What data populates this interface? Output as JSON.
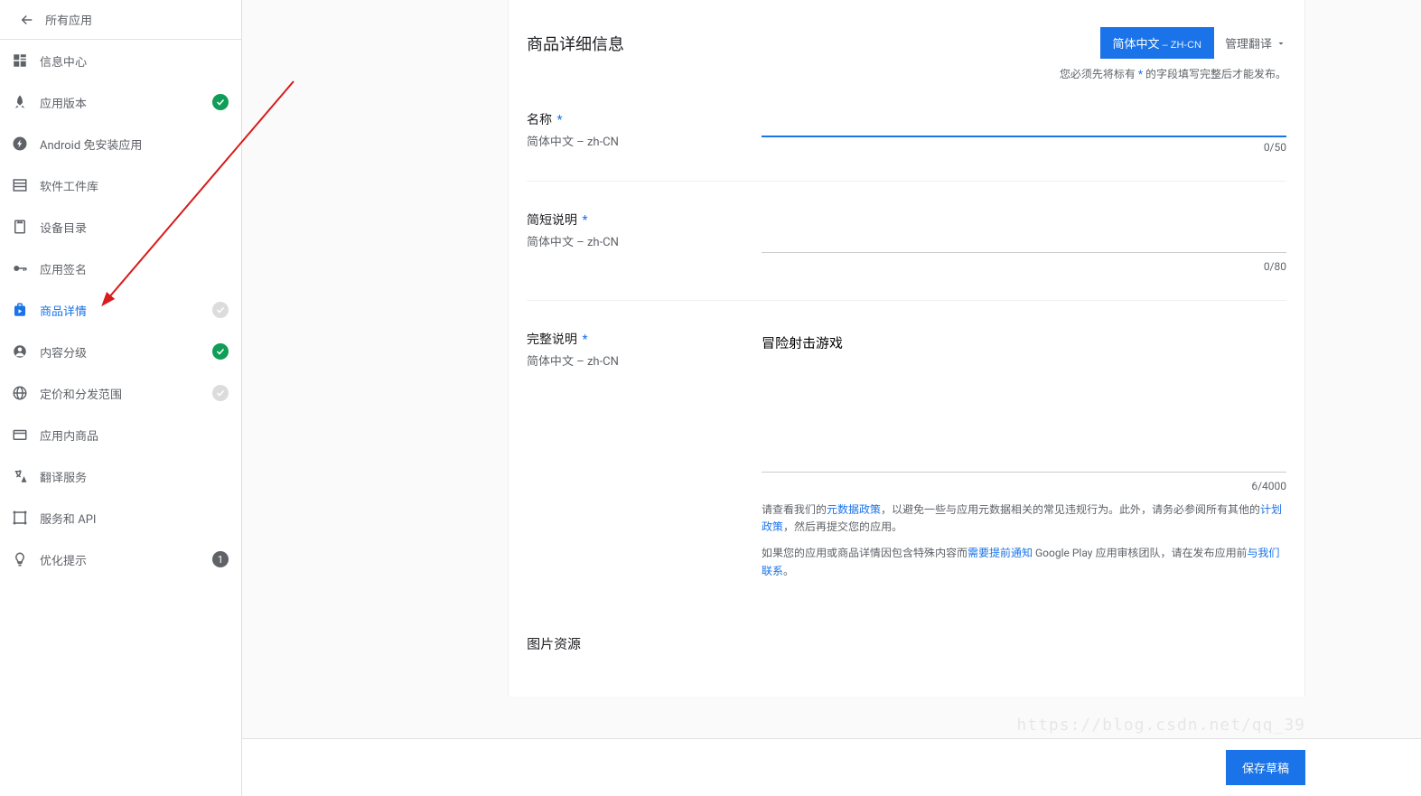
{
  "sidebar": {
    "back_label": "所有应用",
    "items": [
      {
        "label": "信息中心",
        "icon": "dashboard",
        "status": null,
        "active": false
      },
      {
        "label": "应用版本",
        "icon": "rocket",
        "status": "complete",
        "active": false
      },
      {
        "label": "Android 免安装应用",
        "icon": "bolt",
        "status": null,
        "active": false
      },
      {
        "label": "软件工件库",
        "icon": "library",
        "status": null,
        "active": false
      },
      {
        "label": "设备目录",
        "icon": "device",
        "status": null,
        "active": false
      },
      {
        "label": "应用签名",
        "icon": "key",
        "status": null,
        "active": false
      },
      {
        "label": "商品详情",
        "icon": "shop",
        "status": "incomplete",
        "active": true
      },
      {
        "label": "内容分级",
        "icon": "rating",
        "status": "complete",
        "active": false
      },
      {
        "label": "定价和分发范围",
        "icon": "globe",
        "status": "incomplete",
        "active": false
      },
      {
        "label": "应用内商品",
        "icon": "card",
        "status": null,
        "active": false
      },
      {
        "label": "翻译服务",
        "icon": "translate",
        "status": null,
        "active": false
      },
      {
        "label": "服务和 API",
        "icon": "api",
        "status": null,
        "active": false
      },
      {
        "label": "优化提示",
        "icon": "bulb",
        "status": null,
        "active": false,
        "badge": "1"
      }
    ]
  },
  "header": {
    "title": "商品详细信息",
    "lang_btn_main": "简体中文",
    "lang_btn_sub": " – ZH-CN",
    "manage_translations": "管理翻译",
    "required_note_prefix": "您必须先将标有 ",
    "required_note_star": "*",
    "required_note_suffix": " 的字段填写完整后才能发布。"
  },
  "fields": {
    "name": {
      "label": "名称",
      "sublabel": "简体中文 – zh-CN",
      "value": "",
      "count": "0/50"
    },
    "short_desc": {
      "label": "简短说明",
      "sublabel": "简体中文 – zh-CN",
      "value": "",
      "count": "0/80"
    },
    "full_desc": {
      "label": "完整说明",
      "sublabel": "简体中文 – zh-CN",
      "value": "冒险射击游戏",
      "count": "6/4000"
    }
  },
  "help": {
    "p1_a": "请查看我们的",
    "p1_link1": "元数据政策",
    "p1_b": "，以避免一些与应用元数据相关的常见违规行为。此外，请务必参阅所有其他的",
    "p1_link2": "计划政策",
    "p1_c": "，然后再提交您的应用。",
    "p2_a": "如果您的应用或商品详情因包含特殊内容而",
    "p2_link1": "需要提前通知",
    "p2_b": " Google Play 应用审核团队，请在发布应用前",
    "p2_link2": "与我们联系",
    "p2_c": "。"
  },
  "section_images": "图片资源",
  "footer": {
    "save_draft": "保存草稿"
  },
  "watermark": "https://blog.csdn.net/qq_39"
}
